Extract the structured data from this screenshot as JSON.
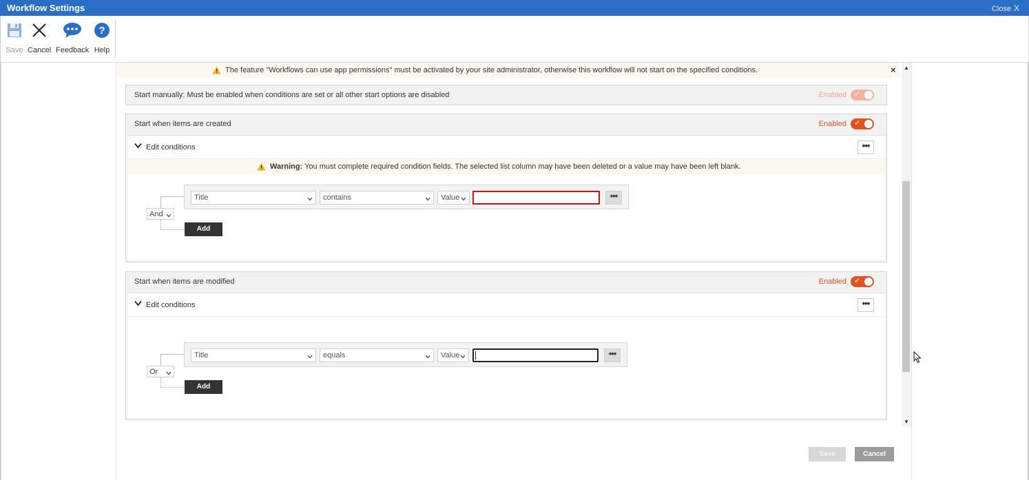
{
  "window": {
    "title": "Workflow Settings",
    "close_label": "Close",
    "close_glyph": "X"
  },
  "toolbar": {
    "save_label": "Save",
    "cancel_label": "Cancel",
    "feedback_label": "Feedback",
    "help_label": "Help"
  },
  "feature_warning": {
    "text": "The feature \"Workflows can use app permissions\" must be activated by your site administrator, otherwise this workflow will not start on the specified conditions.",
    "close_glyph": "×"
  },
  "start_manual": {
    "label": "Start manually: Must be enabled when conditions are set or all other start options are disabled",
    "status": "Enabled"
  },
  "start_created": {
    "label": "Start when items are created",
    "status": "Enabled",
    "edit_conditions_label": "Edit conditions",
    "warning_bold": "Warning:",
    "warning_text": " You must complete required condition fields. The selected list column may have been deleted or a value may have been left blank.",
    "logic": "And",
    "column": "Title",
    "operator": "contains",
    "value_type": "Value",
    "value": "",
    "add_label": "Add"
  },
  "start_modified": {
    "label": "Start when items are modified",
    "status": "Enabled",
    "edit_conditions_label": "Edit conditions",
    "logic": "Or",
    "column": "Title",
    "operator": "equals",
    "value_type": "Value",
    "value": "",
    "add_label": "Add"
  },
  "footer": {
    "save_label": "Save",
    "cancel_label": "Cancel"
  },
  "colors": {
    "title_bar": "#2b6ec6",
    "toggle_on": "#e1531f",
    "warning_bg": "#fdf8ef",
    "invalid_border": "#d11313"
  }
}
